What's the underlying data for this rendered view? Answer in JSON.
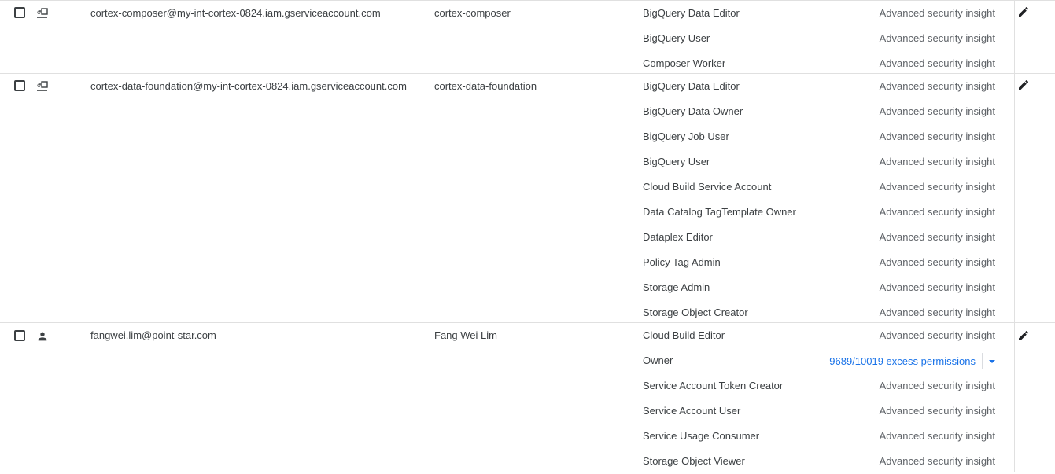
{
  "rows": [
    {
      "principal": "cortex-composer@my-int-cortex-0824.iam.gserviceaccount.com",
      "name": "cortex-composer",
      "type_icon": "service-account-icon",
      "roles": [
        {
          "role": "BigQuery Data Editor",
          "insight": "Advanced security insight"
        },
        {
          "role": "BigQuery User",
          "insight": "Advanced security insight"
        },
        {
          "role": "Composer Worker",
          "insight": "Advanced security insight"
        }
      ]
    },
    {
      "principal": "cortex-data-foundation@my-int-cortex-0824.iam.gserviceaccount.com",
      "name": "cortex-data-foundation",
      "type_icon": "service-account-icon",
      "roles": [
        {
          "role": "BigQuery Data Editor",
          "insight": "Advanced security insight"
        },
        {
          "role": "BigQuery Data Owner",
          "insight": "Advanced security insight"
        },
        {
          "role": "BigQuery Job User",
          "insight": "Advanced security insight"
        },
        {
          "role": "BigQuery User",
          "insight": "Advanced security insight"
        },
        {
          "role": "Cloud Build Service Account",
          "insight": "Advanced security insight"
        },
        {
          "role": "Data Catalog TagTemplate Owner",
          "insight": "Advanced security insight"
        },
        {
          "role": "Dataplex Editor",
          "insight": "Advanced security insight"
        },
        {
          "role": "Policy Tag Admin",
          "insight": "Advanced security insight"
        },
        {
          "role": "Storage Admin",
          "insight": "Advanced security insight"
        },
        {
          "role": "Storage Object Creator",
          "insight": "Advanced security insight"
        }
      ]
    },
    {
      "principal": "fangwei.lim@point-star.com",
      "name": "Fang Wei Lim",
      "type_icon": "person-icon",
      "roles": [
        {
          "role": "Cloud Build Editor",
          "insight": "Advanced security insight"
        },
        {
          "role": "Owner",
          "excess_count": "9689",
          "excess_rest": "/10019 excess permissions"
        },
        {
          "role": "Service Account Token Creator",
          "insight": "Advanced security insight"
        },
        {
          "role": "Service Account User",
          "insight": "Advanced security insight"
        },
        {
          "role": "Service Usage Consumer",
          "insight": "Advanced security insight"
        },
        {
          "role": "Storage Object Viewer",
          "insight": "Advanced security insight"
        }
      ]
    }
  ],
  "colors": {
    "text": "#3c4043",
    "secondary_text": "#5f6368",
    "link": "#1a73e8",
    "divider": "#e0e0e0"
  }
}
